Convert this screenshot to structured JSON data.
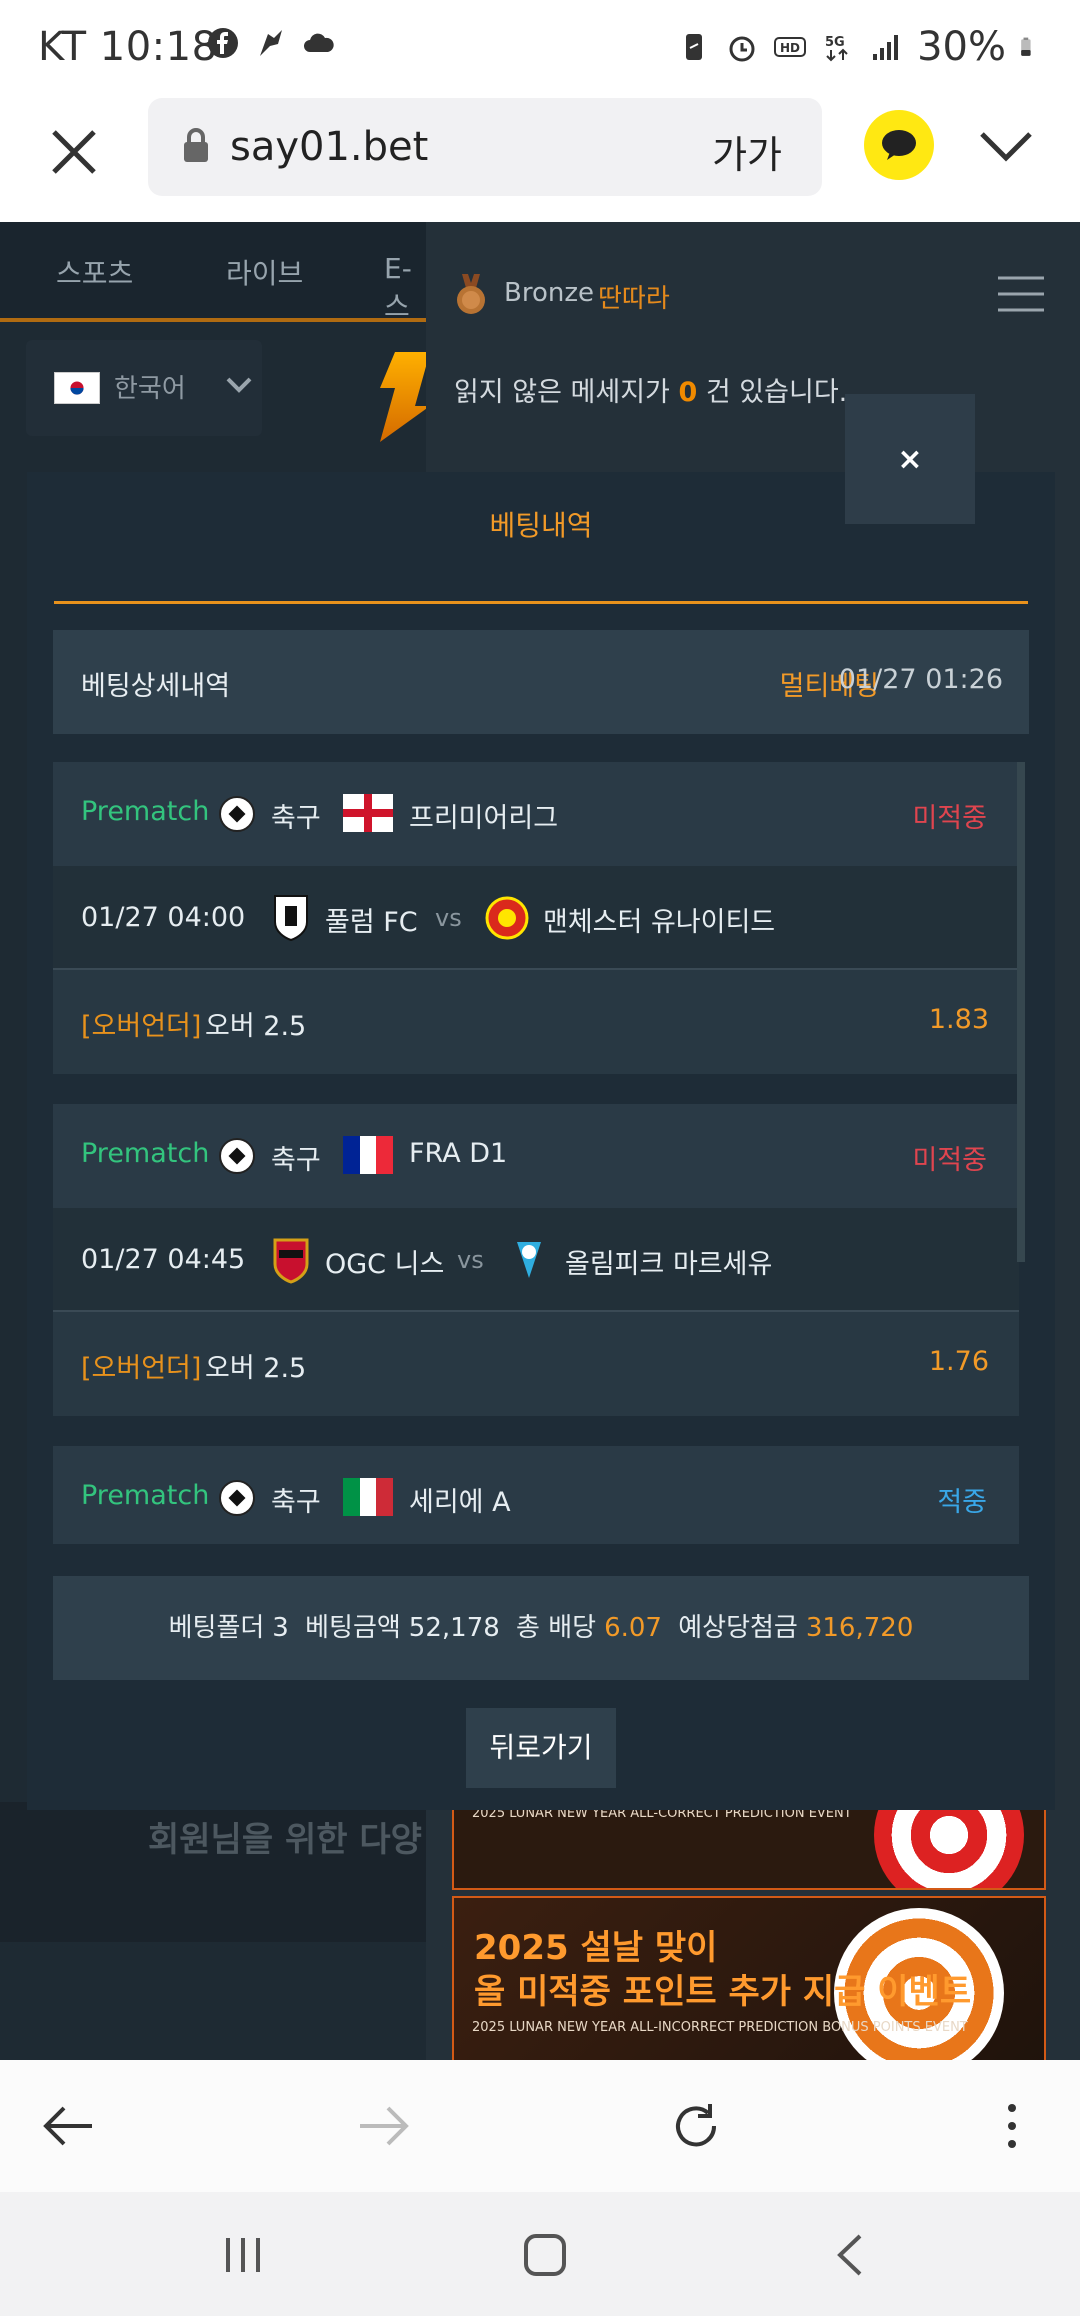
{
  "status_bar": {
    "carrier": "KT",
    "time": "10:18",
    "battery": "30%"
  },
  "browser": {
    "url": "say01.bet",
    "text_size_label": "가가"
  },
  "background": {
    "nav_tabs": [
      "스포츠",
      "라이브",
      "E-스"
    ],
    "language": "한국어",
    "user": {
      "grade": "Bronze",
      "nickname": "딴따라"
    },
    "unread": {
      "prefix": "읽지 않은 메세지가",
      "count": "0",
      "suffix": "건 있습니다."
    },
    "promo_text": "회원님을 위한 다양",
    "banners": [
      {
        "title": "",
        "subtitle": "2025 LUNAR NEW YEAR ALL-CORRECT PREDICTION EVENT"
      },
      {
        "title_line1": "2025 설날 맞이",
        "title_line2": "올 미적중 포인트 추가 지급 이벤트",
        "subtitle": "2025 LUNAR NEW YEAR ALL-INCORRECT PREDICTION BONUS POINTS EVENT"
      }
    ]
  },
  "modal": {
    "title": "베팅내역",
    "close_label": "×",
    "detail": {
      "label": "베팅상세내역",
      "bet_type": "멀티베팅",
      "datetime": "01/27 01:26"
    },
    "bets": [
      {
        "stage": "Prematch",
        "sport": "축구",
        "league": "프리미어리그",
        "status": "미적중",
        "time": "01/27 04:00",
        "home": "풀럼 FC",
        "vs": "vs",
        "away": "맨체스터 유나이티드",
        "market": "[오버언더]",
        "pick": "오버 2.5",
        "odds": "1.83"
      },
      {
        "stage": "Prematch",
        "sport": "축구",
        "league": "FRA D1",
        "status": "미적중",
        "time": "01/27 04:45",
        "home": "OGC 니스",
        "vs": "vs",
        "away": "올림피크 마르세유",
        "market": "[오버언더]",
        "pick": "오버 2.5",
        "odds": "1.76"
      },
      {
        "stage": "Prematch",
        "sport": "축구",
        "league": "세리에 A",
        "status": "적중"
      }
    ],
    "summary": {
      "folder_label": "베팅폴더",
      "folder_value": "3",
      "amount_label": "베팅금액",
      "amount_value": "52,178",
      "odds_label": "총 배당",
      "odds_value": "6.07",
      "payout_label": "예상당첨금",
      "payout_value": "316,720"
    },
    "back_label": "뒤로가기"
  }
}
